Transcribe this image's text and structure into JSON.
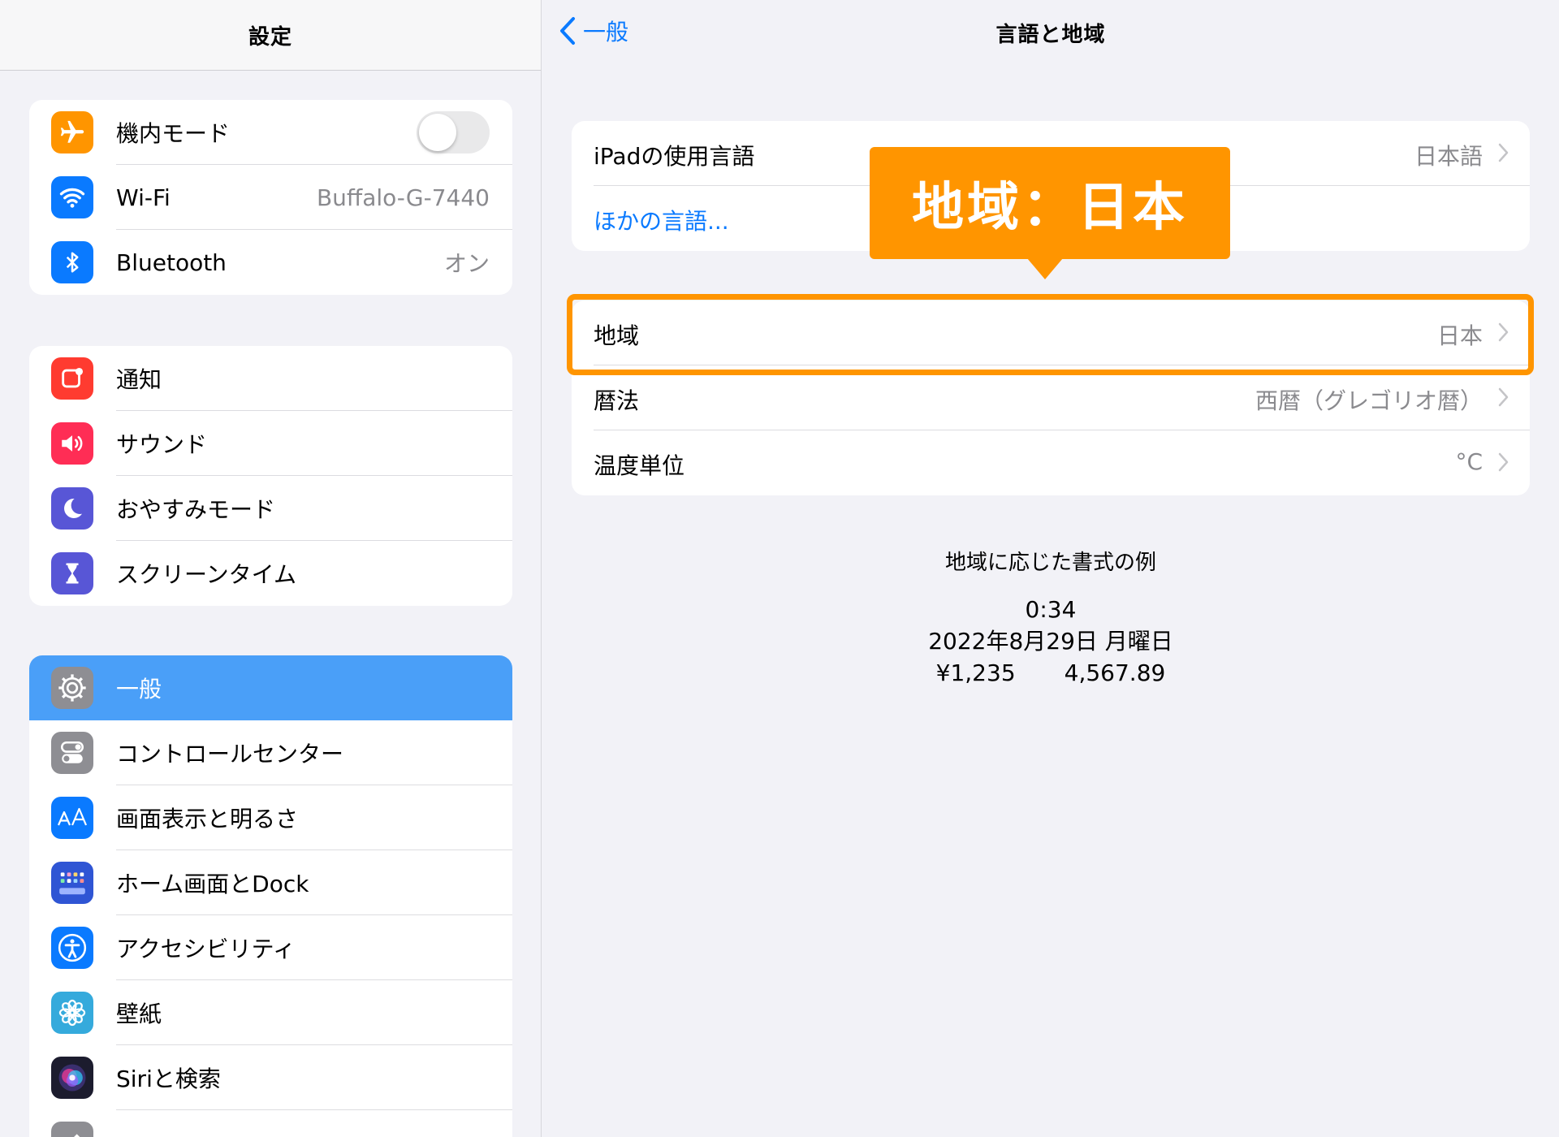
{
  "sidebar": {
    "title": "設定",
    "groups": [
      [
        {
          "label": "機内モード",
          "icon": "airplane-icon",
          "color": "#ff9500",
          "toggle": false
        },
        {
          "label": "Wi-Fi",
          "icon": "wifi-icon",
          "color": "#0a7aff",
          "value": "Buffalo-G-7440"
        },
        {
          "label": "Bluetooth",
          "icon": "bluetooth-icon",
          "color": "#0a7aff",
          "value": "オン"
        }
      ],
      [
        {
          "label": "通知",
          "icon": "notifications-icon",
          "color": "#ff3b30"
        },
        {
          "label": "サウンド",
          "icon": "speaker-icon",
          "color": "#ff2d55"
        },
        {
          "label": "おやすみモード",
          "icon": "moon-icon",
          "color": "#5856d6"
        },
        {
          "label": "スクリーンタイム",
          "icon": "hourglass-icon",
          "color": "#5856d6"
        }
      ],
      [
        {
          "label": "一般",
          "icon": "gear-icon",
          "color": "#8e8e93",
          "selected": true
        },
        {
          "label": "コントロールセンター",
          "icon": "control-center-icon",
          "color": "#8e8e93"
        },
        {
          "label": "画面表示と明るさ",
          "icon": "display-aa-icon",
          "color": "#0a7aff"
        },
        {
          "label": "ホーム画面とDock",
          "icon": "home-screen-grid-icon",
          "color": "#2f55d4"
        },
        {
          "label": "アクセシビリティ",
          "icon": "accessibility-icon",
          "color": "#0a7aff"
        },
        {
          "label": "壁紙",
          "icon": "wallpaper-flower-icon",
          "color": "#35aadc"
        },
        {
          "label": "Siriと検索",
          "icon": "siri-icon",
          "color": "#1c1c2e"
        },
        {
          "label": "",
          "icon": "pencil-icon",
          "color": "#8e8e93"
        }
      ]
    ]
  },
  "main": {
    "back_label": "一般",
    "title": "言語と地域",
    "language_group": {
      "ipad_language_label": "iPadの使用言語",
      "ipad_language_value": "日本語",
      "other_languages_label": "ほかの言語..."
    },
    "region_group": {
      "region_label": "地域",
      "region_value": "日本",
      "calendar_label": "暦法",
      "calendar_value": "西暦（グレゴリオ暦）",
      "temperature_label": "温度単位",
      "temperature_value": "°C"
    },
    "callout_text": "地域：日本",
    "example": {
      "title": "地域に応じた書式の例",
      "time": "0:34",
      "date": "2022年8月29日 月曜日",
      "currency": "¥1,235",
      "number": "4,567.89"
    }
  },
  "colors": {
    "accent": "#0a7aff",
    "highlight": "#ff9500",
    "selected_row": "#4a9ff8"
  }
}
